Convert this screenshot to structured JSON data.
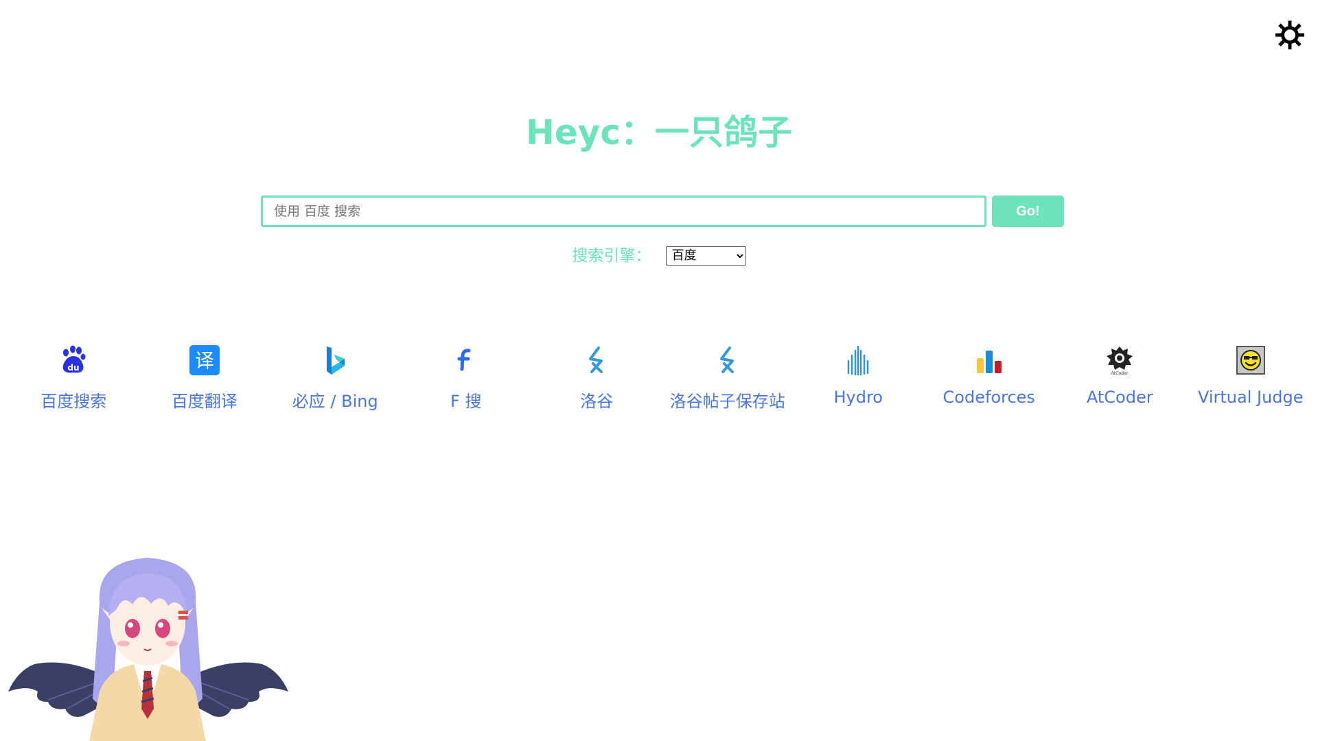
{
  "header": {
    "title": "Heyc：一只鸽子"
  },
  "search": {
    "placeholder": "使用 百度 搜索",
    "value": "",
    "button_label": "Go!"
  },
  "engine": {
    "label": "搜索引擎：",
    "selected": "百度"
  },
  "links": [
    {
      "label": "百度搜索",
      "icon": "baidu-paw-icon"
    },
    {
      "label": "百度翻译",
      "icon": "translate-icon"
    },
    {
      "label": "必应 / Bing",
      "icon": "bing-icon"
    },
    {
      "label": "F 搜",
      "icon": "f-search-icon"
    },
    {
      "label": "洛谷",
      "icon": "luogu-icon"
    },
    {
      "label": "洛谷帖子保存站",
      "icon": "luogu-icon"
    },
    {
      "label": "Hydro",
      "icon": "hydro-icon"
    },
    {
      "label": "Codeforces",
      "icon": "codeforces-icon"
    },
    {
      "label": "AtCoder",
      "icon": "atcoder-icon"
    },
    {
      "label": "Virtual Judge",
      "icon": "vjudge-icon"
    }
  ],
  "colors": {
    "accent": "#6ce3bd",
    "link": "#4a75e0"
  }
}
